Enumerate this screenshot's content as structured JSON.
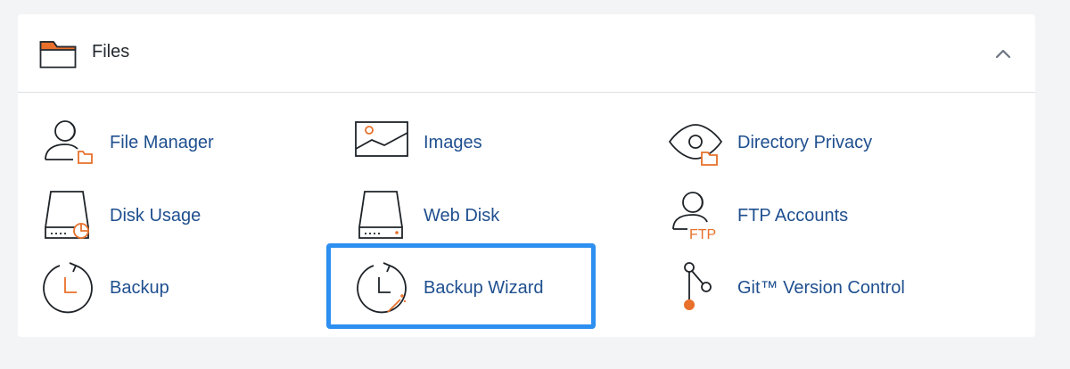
{
  "section": {
    "title": "Files",
    "icon": "folder-icon",
    "collapse_icon": "chevron-up-icon"
  },
  "colors": {
    "accent": "#e8702a",
    "link": "#1f4f8f",
    "highlight": "#2d8ff0"
  },
  "items": [
    {
      "label": "File Manager",
      "icon": "file-manager-icon"
    },
    {
      "label": "Images",
      "icon": "images-icon"
    },
    {
      "label": "Directory Privacy",
      "icon": "directory-privacy-icon"
    },
    {
      "label": "Disk Usage",
      "icon": "disk-usage-icon"
    },
    {
      "label": "Web Disk",
      "icon": "web-disk-icon"
    },
    {
      "label": "FTP Accounts",
      "icon": "ftp-accounts-icon",
      "icon_text": "FTP"
    },
    {
      "label": "Backup",
      "icon": "backup-icon"
    },
    {
      "label": "Backup Wizard",
      "icon": "backup-wizard-icon",
      "highlighted": true
    },
    {
      "label": "Git™ Version Control",
      "icon": "git-icon"
    }
  ]
}
